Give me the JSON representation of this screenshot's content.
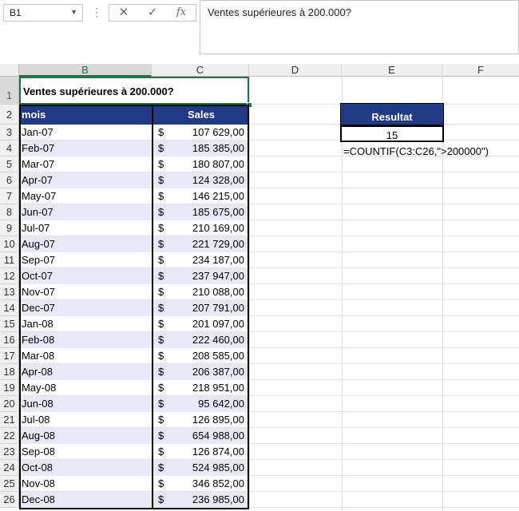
{
  "name_box": {
    "value": "B1"
  },
  "formula_bar": {
    "cancel_symbol": "✕",
    "enter_symbol": "✓",
    "fx_label": "fx",
    "content": "Ventes supérieures à 200.000?"
  },
  "columns": [
    "B",
    "C",
    "D",
    "E",
    "F"
  ],
  "rows": [
    "1",
    "2",
    "3",
    "4",
    "5",
    "6",
    "7",
    "8",
    "9",
    "10",
    "11",
    "12",
    "13",
    "14",
    "15",
    "16",
    "17",
    "18",
    "19",
    "20",
    "21",
    "22",
    "23",
    "24",
    "25",
    "26"
  ],
  "sheet": {
    "title": "Ventes supérieures à 200.000?",
    "header_month": "mois",
    "header_sales": "Sales",
    "currency": "$",
    "records": [
      {
        "month": "Jan-07",
        "sales": "107 629,00"
      },
      {
        "month": "Feb-07",
        "sales": "185 385,00"
      },
      {
        "month": "Mar-07",
        "sales": "180 807,00"
      },
      {
        "month": "Apr-07",
        "sales": "124 328,00"
      },
      {
        "month": "May-07",
        "sales": "146 215,00"
      },
      {
        "month": "Jun-07",
        "sales": "185 675,00"
      },
      {
        "month": "Jul-07",
        "sales": "210 169,00"
      },
      {
        "month": "Aug-07",
        "sales": "221 729,00"
      },
      {
        "month": "Sep-07",
        "sales": "234 187,00"
      },
      {
        "month": "Oct-07",
        "sales": "237 947,00"
      },
      {
        "month": "Nov-07",
        "sales": "210 088,00"
      },
      {
        "month": "Dec-07",
        "sales": "207 791,00"
      },
      {
        "month": "Jan-08",
        "sales": "201 097,00"
      },
      {
        "month": "Feb-08",
        "sales": "222 460,00"
      },
      {
        "month": "Mar-08",
        "sales": "208 585,00"
      },
      {
        "month": "Apr-08",
        "sales": "206 387,00"
      },
      {
        "month": "May-08",
        "sales": "218 951,00"
      },
      {
        "month": "Jun-08",
        "sales": "95 642,00"
      },
      {
        "month": "Jul-08",
        "sales": "126 895,00"
      },
      {
        "month": "Aug-08",
        "sales": "654 988,00"
      },
      {
        "month": "Sep-08",
        "sales": "126 874,00"
      },
      {
        "month": "Oct-08",
        "sales": "524 985,00"
      },
      {
        "month": "Nov-08",
        "sales": "346 852,00"
      },
      {
        "month": "Dec-08",
        "sales": "236 985,00"
      }
    ]
  },
  "result": {
    "header": "Resultat",
    "value": "15",
    "formula": "=COUNTIF(C3:C26,\">200000\")"
  },
  "colors": {
    "header_fill": "#203a85",
    "stripe_fill": "#e8e9f6",
    "selection": "#217346"
  }
}
